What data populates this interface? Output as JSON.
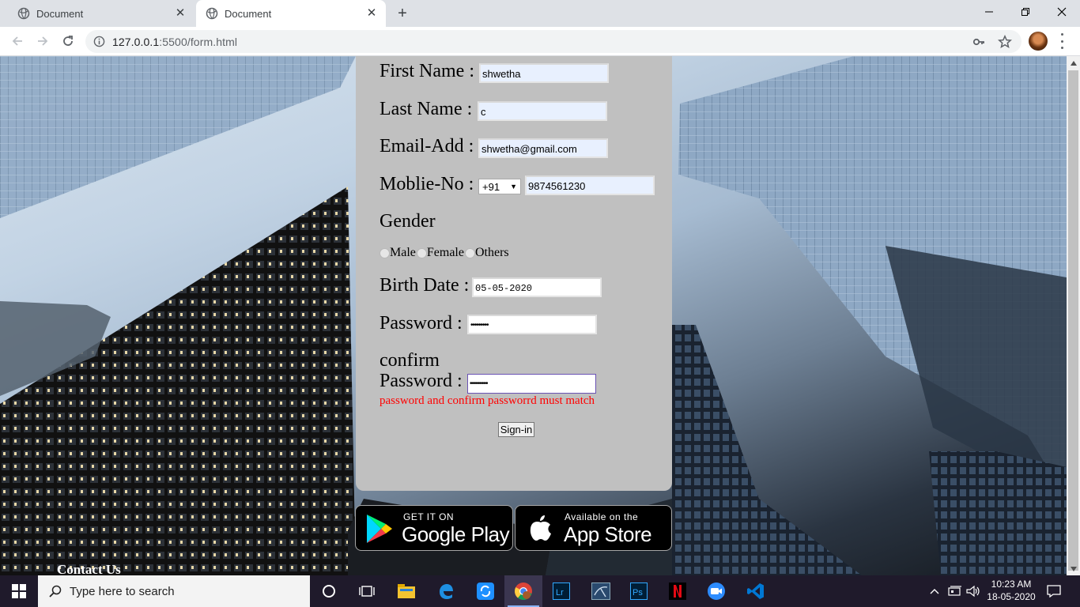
{
  "browser": {
    "tabs": [
      {
        "title": "Document"
      },
      {
        "title": "Document"
      }
    ],
    "url_host": "127.0.0.1",
    "url_rest": ":5500/form.html"
  },
  "form": {
    "first_name_label": "First Name :",
    "first_name_value": "shwetha",
    "last_name_label": "Last Name :",
    "last_name_value": "c",
    "email_label": "Email-Add :",
    "email_value": "shwetha@gmail.com",
    "mobile_label": "Moblie-No :",
    "country_code": "+91",
    "mobile_value": "9874561230",
    "gender_label": "Gender",
    "gender_options": [
      "Male",
      "Female",
      "Others"
    ],
    "birth_label": "Birth Date :",
    "birth_value": "05-05-2020",
    "password_label": "Password :",
    "password_value": "•••••••••",
    "confirm_label_1": "confirm",
    "confirm_label_2": "Password :",
    "confirm_value": "•••••••••",
    "error_text": "password and confirm passworrd must match",
    "submit_label": "Sign-in"
  },
  "badges": {
    "google_small": "GET IT ON",
    "google_big": "Google Play",
    "apple_small": "Available on the",
    "apple_big": "App Store"
  },
  "footer": {
    "contact": "Contact Us"
  },
  "taskbar": {
    "search_placeholder": "Type here to search",
    "time": "10:23 AM",
    "date": "18-05-2020"
  },
  "colors": {
    "card": "#c0c0c0",
    "error": "#ff0000",
    "autofill": "#e8f0fe"
  }
}
